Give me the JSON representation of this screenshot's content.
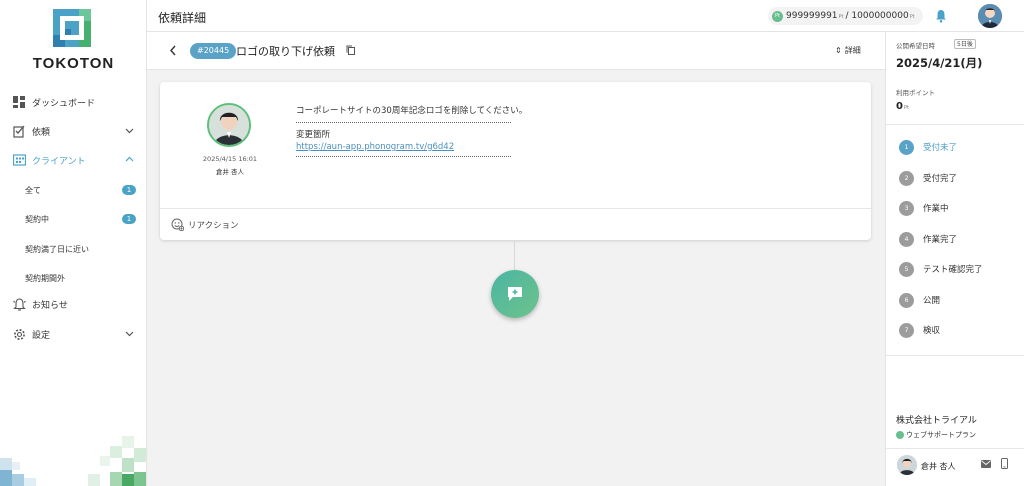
{
  "app": {
    "name": "TOKOTON"
  },
  "sidebar": {
    "items": [
      {
        "label": "ダッシュボード",
        "icon": "dashboard-icon"
      },
      {
        "label": "依頼",
        "icon": "request-icon"
      },
      {
        "label": "クライアント",
        "icon": "client-icon",
        "active": true
      },
      {
        "label": "お知らせ",
        "icon": "bell-icon"
      },
      {
        "label": "設定",
        "icon": "gear-icon"
      }
    ],
    "client_sub": [
      {
        "label": "全て",
        "count": "1"
      },
      {
        "label": "契約中",
        "count": "1"
      },
      {
        "label": "契約満了日に近い",
        "count": ""
      },
      {
        "label": "契約期間外",
        "count": ""
      }
    ]
  },
  "header": {
    "title": "依頼詳細",
    "points_value": "999999991",
    "points_unit": "Pt",
    "points_total": "/ 1000000000",
    "points_icon_text": "Pt"
  },
  "ticket": {
    "number": "#20445",
    "title": "ロゴの取り下げ依頼",
    "detail_label": "詳細"
  },
  "comment": {
    "date": "2025/4/15 16:01",
    "author": "倉井 杏人",
    "text": "コーポレートサイトの30周年記念ロゴを削除してください。",
    "change_label": "変更箇所",
    "link": "https://aun-app.phonogram.tv/g6d42",
    "reaction_label": "リアクション"
  },
  "panel": {
    "publish_label": "公開希望日時",
    "days_badge": "5日後",
    "publish_date": "2025/4/21(月)",
    "use_points_label": "利用ポイント",
    "use_points": "0",
    "use_points_unit": "Pt",
    "steps": [
      {
        "num": "1",
        "label": "受付未了",
        "current": true
      },
      {
        "num": "2",
        "label": "受付完了"
      },
      {
        "num": "3",
        "label": "作業中"
      },
      {
        "num": "4",
        "label": "作業完了"
      },
      {
        "num": "5",
        "label": "テスト確認完了"
      },
      {
        "num": "6",
        "label": "公開"
      },
      {
        "num": "7",
        "label": "検収"
      }
    ],
    "company": "株式会社トライアル",
    "plan": "ウェブサポートプラン",
    "staff_name": "倉井 杏人"
  },
  "colors": {
    "accent": "#5aa3c7",
    "green": "#6ec28a"
  }
}
